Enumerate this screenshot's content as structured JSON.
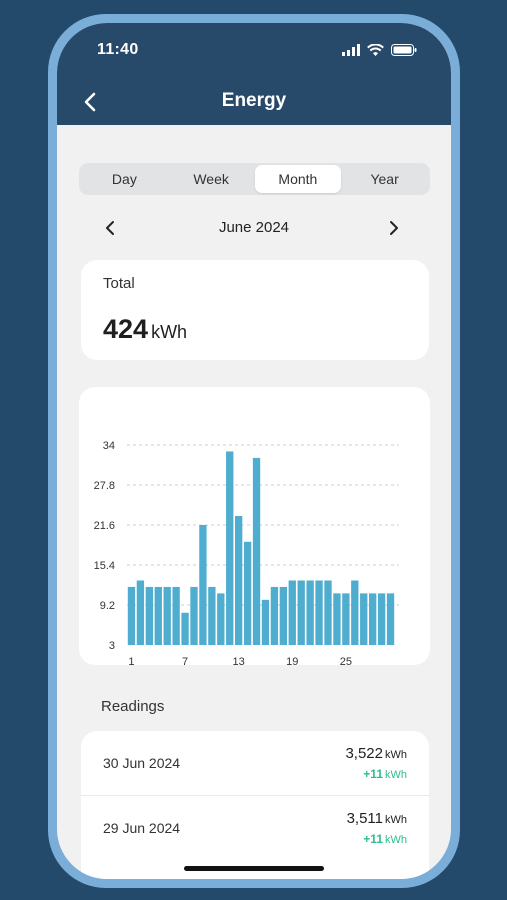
{
  "status_bar": {
    "time": "11:40"
  },
  "header": {
    "title": "Energy"
  },
  "tabs": [
    {
      "label": "Day",
      "active": false
    },
    {
      "label": "Week",
      "active": false
    },
    {
      "label": "Month",
      "active": true
    },
    {
      "label": "Year",
      "active": false
    }
  ],
  "period": {
    "label": "June 2024"
  },
  "total": {
    "label": "Total",
    "value": "424",
    "unit": "kWh"
  },
  "chart_data": {
    "type": "bar",
    "x": [
      1,
      2,
      3,
      4,
      5,
      6,
      7,
      8,
      9,
      10,
      11,
      12,
      13,
      14,
      15,
      16,
      17,
      18,
      19,
      20,
      21,
      22,
      23,
      24,
      25,
      26,
      27,
      28,
      29,
      30
    ],
    "values": [
      12,
      13,
      12,
      12,
      12,
      12,
      8,
      12,
      21.6,
      12,
      11,
      33,
      23,
      19,
      32,
      10,
      12,
      12,
      13,
      13,
      13,
      13,
      13,
      11,
      11,
      13,
      11,
      11,
      11,
      11
    ],
    "ylim": [
      3,
      34
    ],
    "yticks": [
      "3",
      "9.2",
      "15.4",
      "21.6",
      "27.8",
      "34"
    ],
    "xticks": [
      "1",
      "7",
      "13",
      "19",
      "25"
    ],
    "bar_color": "#4fadcf",
    "grid": true
  },
  "readings": {
    "title": "Readings",
    "items": [
      {
        "date": "30 Jun 2024",
        "value": "3,522",
        "unit": "kWh",
        "delta": "+11",
        "delta_unit": "kWh"
      },
      {
        "date": "29 Jun 2024",
        "value": "3,511",
        "unit": "kWh",
        "delta": "+11",
        "delta_unit": "kWh"
      }
    ]
  },
  "colors": {
    "header": "#274a6a",
    "background": "#234a6b",
    "frame": "#7aaed8",
    "accent_green": "#2fbd8f"
  }
}
